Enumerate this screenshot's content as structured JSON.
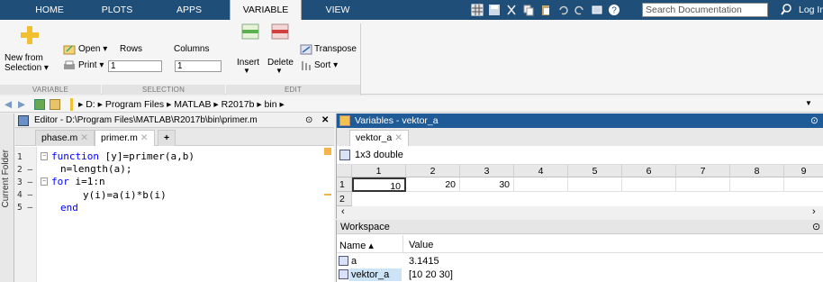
{
  "tabs": [
    "HOME",
    "PLOTS",
    "APPS",
    "VARIABLE",
    "VIEW"
  ],
  "search_placeholder": "Search Documentation",
  "login_label": "Log In",
  "ribbon": {
    "new_from_selection": [
      "New from",
      "Selection ▾"
    ],
    "open_label": "Open ▾",
    "print_label": "Print ▾",
    "rows_label": "Rows",
    "columns_label": "Columns",
    "rows_value": "1",
    "columns_value": "1",
    "insert_label": "Insert",
    "delete_label": "Delete",
    "transpose_label": "Transpose",
    "sort_label": "Sort ▾",
    "groups": [
      "VARIABLE",
      "SELECTION",
      "EDIT"
    ]
  },
  "path": [
    "D:",
    "Program Files",
    "MATLAB",
    "R2017b",
    "bin"
  ],
  "current_folder_label": "Current Folder",
  "editor": {
    "title": "Editor - D:\\Program Files\\MATLAB\\R2017b\\bin\\primer.m",
    "tabs": [
      "phase.m",
      "primer.m"
    ],
    "add_tab": "+",
    "line_numbers": [
      "1",
      "2 —",
      "3 —",
      "4 —",
      "5 —"
    ],
    "code": [
      {
        "kw": "function",
        "rest": " [y]=primer(a,b)"
      },
      {
        "kw": "",
        "rest": "n=length(a);"
      },
      {
        "kw": "for",
        "rest": " i=1:n"
      },
      {
        "kw": "",
        "rest": "y(i)=a(i)*b(i)"
      },
      {
        "kw": "end",
        "rest": ""
      }
    ]
  },
  "variables": {
    "title": "Variables - vektor_a",
    "tab": "vektor_a",
    "type_label": "1x3 double",
    "col_headers": [
      "1",
      "2",
      "3",
      "4",
      "5",
      "6",
      "7",
      "8",
      "9"
    ],
    "row_headers": [
      "1",
      "2"
    ],
    "row1": [
      "10",
      "20",
      "30",
      "",
      "",
      "",
      "",
      "",
      ""
    ]
  },
  "workspace": {
    "title": "Workspace",
    "name_header": "Name ▴",
    "value_header": "Value",
    "rows": [
      {
        "name": "a",
        "value": "3.1415"
      },
      {
        "name": "vektor_a",
        "value": "[10 20 30]"
      }
    ]
  }
}
